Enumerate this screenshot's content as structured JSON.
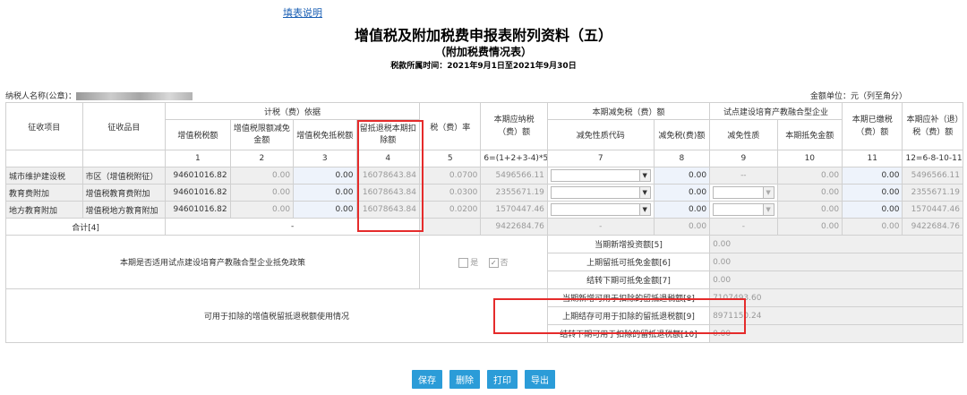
{
  "header": {
    "help_link": "填表说明",
    "title": "增值税及附加税费申报表附列资料（五）",
    "subtitle": "（附加税费情况表）",
    "period": "税款所属时间：2021年9月1日至2021年9月30日"
  },
  "taxpayer": {
    "label": "纳税人名称(公章)：",
    "unit": "金额单位：元（列至角分）"
  },
  "columns": {
    "item": "征收项目",
    "sub_item": "征收品目",
    "basis_group": "计税（费）依据",
    "vat_amount": "增值税税额",
    "vat_limit_reduction": "增值税限额减免金额",
    "vat_exempt_offset": "增值税免抵税额",
    "refund_deduct": "留抵退税本期扣除额",
    "rate": "税（费）率",
    "payable": "本期应纳税（费）额",
    "reduction_group": "本期减免税（费）额",
    "reduction_code": "减免性质代码",
    "reduction_amount": "减免税(费)额",
    "pilot_group": "试点建设培育产教融合型企业",
    "pilot_nature": "减免性质",
    "pilot_offset": "本期抵免金额",
    "paid": "本期已缴税（费）额",
    "refund": "本期应补（退）税（费）额"
  },
  "col_numbers": [
    "1",
    "2",
    "3",
    "4",
    "5",
    "6=(1+2+3-4)*5",
    "7",
    "8",
    "9",
    "10",
    "11",
    "12=6-8-10-11"
  ],
  "rows": [
    {
      "item": "城市维护建设税",
      "sub_item": "市区（增值税附征）",
      "vat": "94601016.82",
      "limit": "0.00",
      "exempt": "0.00",
      "deduct": "16078643.84",
      "rate": "0.0700",
      "payable": "5496566.11",
      "reduce": "0.00",
      "pilot_nature": "--",
      "pilot_offset": "0.00",
      "paid": "0.00",
      "refund": "5496566.11"
    },
    {
      "item": "教育费附加",
      "sub_item": "增值税教育费附加",
      "vat": "94601016.82",
      "limit": "0.00",
      "exempt": "0.00",
      "deduct": "16078643.84",
      "rate": "0.0300",
      "payable": "2355671.19",
      "reduce": "0.00",
      "pilot_nature": "",
      "pilot_offset": "0.00",
      "paid": "0.00",
      "refund": "2355671.19"
    },
    {
      "item": "地方教育附加",
      "sub_item": "增值税地方教育附加",
      "vat": "94601016.82",
      "limit": "0.00",
      "exempt": "0.00",
      "deduct": "16078643.84",
      "rate": "0.0200",
      "payable": "1570447.46",
      "reduce": "0.00",
      "pilot_nature": "",
      "pilot_offset": "0.00",
      "paid": "0.00",
      "refund": "1570447.46"
    }
  ],
  "total": {
    "label": "合计[4]",
    "dash": "-",
    "payable": "9422684.76",
    "code": "-",
    "reduce": "0.00",
    "pilot_nature": "-",
    "pilot_offset": "0.00",
    "paid": "0.00",
    "refund": "9422684.76"
  },
  "policy": {
    "question": "本期是否适用试点建设培育产教融合型企业抵免政策",
    "yes": "是",
    "no": "否",
    "yes_checked": false,
    "no_checked": true,
    "items": [
      {
        "label": "当期新增投资额[5]",
        "value": "0.00"
      },
      {
        "label": "上期留抵可抵免金额[6]",
        "value": "0.00"
      },
      {
        "label": "结转下期可抵免金额[7]",
        "value": "0.00"
      }
    ]
  },
  "refund_usage": {
    "label": "可用于扣除的增值税留抵退税额使用情况",
    "items": [
      {
        "label": "当期新增可用于扣除的留抵退税额[8]",
        "value": "7107493.60"
      },
      {
        "label": "上期结存可用于扣除的留抵退税额[9]",
        "value": "8971150.24"
      },
      {
        "label": "结转下期可用于扣除的留抵退税额[10]",
        "value": "0.00"
      }
    ]
  },
  "buttons": {
    "save": "保存",
    "delete": "删除",
    "print": "打印",
    "export": "导出"
  },
  "colors": {
    "highlight": "#e52b2b",
    "button": "#2b9cd8",
    "link": "#1a5fb4",
    "readonly_bg": "#efefef",
    "editable_bg": "#eef3fb"
  }
}
